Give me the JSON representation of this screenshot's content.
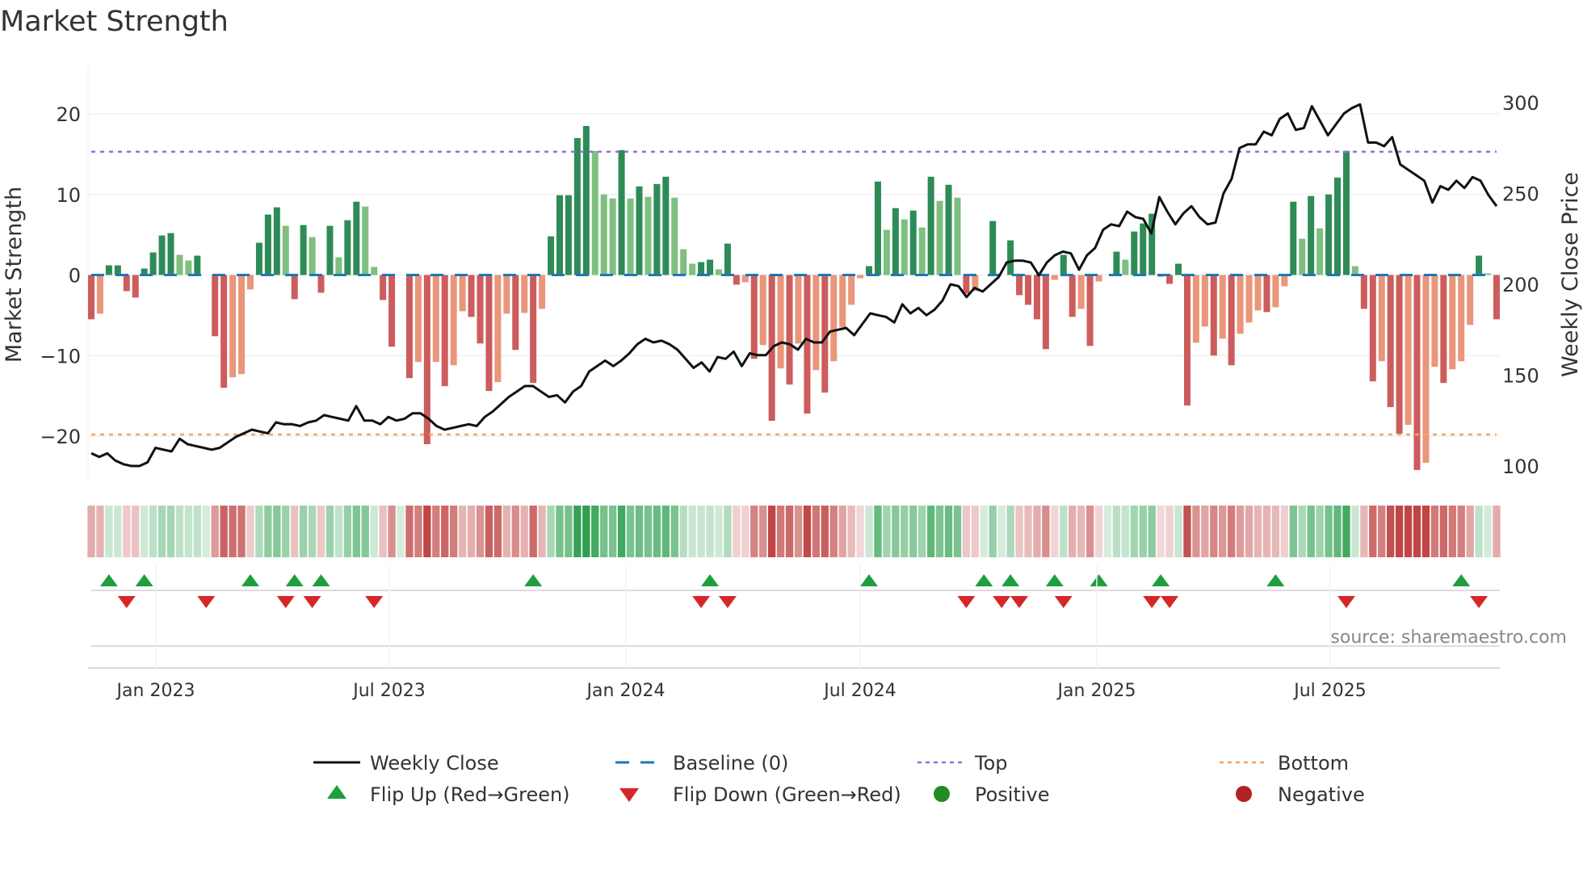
{
  "chart_data": {
    "type": "bar",
    "title": "Market Strength",
    "ylabel": "Market Strength",
    "y2label": "Weekly Close Price",
    "ylim": [
      -26,
      26
    ],
    "y2lim": [
      88,
      318
    ],
    "yticks": [
      "20",
      "10",
      "0",
      "−10",
      "−20"
    ],
    "ytick_values": [
      20,
      10,
      0,
      -10,
      -20
    ],
    "y2ticks": [
      "300",
      "250",
      "200",
      "150",
      "100"
    ],
    "y2tick_values": [
      300,
      250,
      200,
      150,
      100
    ],
    "xticks": [
      "Jan 2023",
      "Jul 2023",
      "Jan 2024",
      "Jul 2024",
      "Jan 2025",
      "Jul 2025"
    ],
    "top_level": 15.3,
    "bottom_level": -19.8,
    "strength": [
      -5.5,
      -4.8,
      1.2,
      1.2,
      -2,
      -2.8,
      0.8,
      2.8,
      4.9,
      5.2,
      2.5,
      1.8,
      2.4,
      0,
      -7.6,
      -14,
      -12.7,
      -12.3,
      -1.8,
      4,
      7.5,
      8.4,
      6.1,
      -3,
      6.2,
      4.7,
      -2.2,
      6.1,
      2.2,
      6.8,
      9.1,
      8.5,
      1,
      -3.1,
      -8.9,
      0,
      -12.8,
      -10.8,
      -21,
      -10.8,
      -13.8,
      -11.2,
      -4.5,
      -5.2,
      -8.5,
      -14.4,
      -13.3,
      -4.8,
      -9.3,
      -4.7,
      -13.4,
      -4.2,
      4.8,
      9.9,
      9.9,
      17,
      18.5,
      15.4,
      10,
      9.5,
      15.5,
      9.5,
      11,
      9.7,
      11.3,
      12.2,
      9.6,
      3.2,
      1.4,
      1.6,
      1.9,
      0.7,
      3.9,
      -1.2,
      -0.9,
      -10.4,
      -8.7,
      -18.1,
      -11.6,
      -13.6,
      -8.5,
      -17.2,
      -11.8,
      -14.6,
      -10.7,
      -6.5,
      -3.7,
      -0.4,
      1.1,
      11.6,
      5.6,
      8.3,
      6.9,
      8,
      5.9,
      12.2,
      9.2,
      11.2,
      9.6,
      -2.3,
      -2,
      0,
      6.7,
      0,
      4.3,
      -2.5,
      -3.7,
      -5.5,
      -9.2,
      -0.6,
      2.5,
      -5.2,
      -4.2,
      -8.8,
      -0.8,
      0,
      2.9,
      1.9,
      5.4,
      6.4,
      7.6,
      -0.2,
      -1.1,
      1.4,
      -16.2,
      -8.4,
      -6.4,
      -10,
      -7.9,
      -11.2,
      -7.3,
      -5.9,
      -4.4,
      -4.6,
      -4,
      -1.4,
      9.1,
      4.5,
      9.8,
      5.8,
      10,
      12.1,
      15.4,
      1.1,
      -4.2,
      -13.2,
      -10.7,
      -16.4,
      -19.7,
      -18.6,
      -24.2,
      -23.3,
      -11.4,
      -13.4,
      -11.7,
      -10.7,
      -6.2,
      2.4,
      0.2,
      -5.5
    ],
    "weekly_close": [
      107,
      105,
      107,
      103,
      101,
      100,
      100,
      102,
      110,
      109,
      108,
      115,
      112,
      111,
      110,
      109,
      110,
      113,
      116,
      118,
      120,
      119,
      118,
      124,
      123,
      123,
      122,
      124,
      125,
      128,
      127,
      126,
      125,
      133,
      125,
      125,
      123,
      127,
      125,
      126,
      129,
      129,
      126,
      122,
      120,
      121,
      122,
      123,
      122,
      127,
      130,
      134,
      138,
      141,
      144,
      144,
      141,
      138,
      139,
      135,
      141,
      144,
      152,
      155,
      158,
      155,
      158,
      162,
      167,
      170,
      168,
      169,
      167,
      164,
      159,
      154,
      157,
      152,
      160,
      159,
      163,
      155,
      162,
      161,
      161,
      166,
      168,
      167,
      164,
      170,
      168,
      168,
      174,
      175,
      176,
      172,
      178,
      184,
      183,
      182,
      179,
      189,
      184,
      187,
      183,
      186,
      191,
      200,
      199,
      193,
      198,
      196,
      200,
      204,
      212,
      213,
      213,
      212,
      205,
      212,
      216,
      218,
      217,
      208,
      216,
      220,
      230,
      233,
      232,
      240,
      237,
      236,
      228,
      248,
      240,
      233,
      239,
      243,
      237,
      233,
      234,
      250,
      258,
      275,
      277,
      277,
      284,
      282,
      291,
      294,
      285,
      286,
      298,
      290,
      282,
      288,
      294,
      297,
      299,
      278,
      278,
      276,
      281,
      266,
      263,
      260,
      257,
      245,
      254,
      252,
      257,
      253,
      259,
      257,
      249,
      243
    ],
    "flip_up_indices": [
      2,
      6,
      18,
      23,
      26,
      50,
      70,
      88,
      101,
      104,
      109,
      114,
      121,
      134,
      155
    ],
    "flip_down_indices": [
      4,
      13,
      22,
      25,
      32,
      69,
      72,
      99,
      103,
      105,
      110,
      120,
      122,
      142,
      157
    ],
    "legend": [
      "Weekly Close",
      "Baseline (0)",
      "Top",
      "Bottom",
      "Flip Up (Red→Green)",
      "Flip Down (Green→Red)",
      "Positive",
      "Negative"
    ],
    "legend_placement": "bottom",
    "colors": {
      "pos_strong": "#2e8b57",
      "pos_weak": "#7fbf7f",
      "neg_strong": "#cd5c5c",
      "neg_weak": "#e9967a",
      "price": "#111111",
      "baseline": "#1f77b4",
      "top": "#9370db",
      "bottom": "#f4a460",
      "flip_up": "#1e9e3e",
      "flip_down": "#d62728",
      "positive_dot": "#228b22",
      "negative_dot": "#b22222"
    }
  },
  "source": "source: sharemaestro.com"
}
